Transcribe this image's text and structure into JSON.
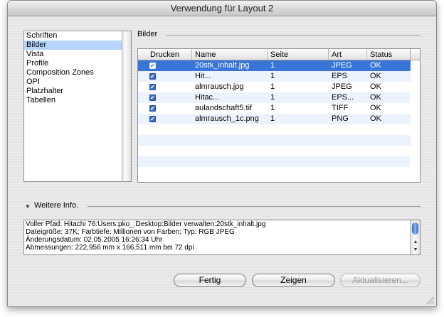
{
  "window": {
    "title": "Verwendung für Layout 2"
  },
  "categories": [
    {
      "label": "Schriften",
      "selected": false
    },
    {
      "label": "Bilder",
      "selected": true
    },
    {
      "label": "Vista",
      "selected": false
    },
    {
      "label": "Profile",
      "selected": false
    },
    {
      "label": "Composition Zones",
      "selected": false
    },
    {
      "label": "OPI",
      "selected": false
    },
    {
      "label": "Platzhalter",
      "selected": false
    },
    {
      "label": "Tabellen",
      "selected": false
    }
  ],
  "images_group": {
    "title": "Bilder",
    "columns": [
      "Drucken",
      "Name",
      "Seite",
      "Art",
      "Status"
    ],
    "rows": [
      {
        "print": true,
        "name": "20stk_inhalt.jpg",
        "page": "1",
        "type": "JPEG",
        "status": "OK",
        "selected": true
      },
      {
        "print": true,
        "name": "Hit...",
        "page": "1",
        "type": "EPS",
        "status": "OK",
        "selected": false
      },
      {
        "print": true,
        "name": "almrausch.jpg",
        "page": "1",
        "type": "JPEG",
        "status": "OK",
        "selected": false
      },
      {
        "print": true,
        "name": "Hitac...",
        "page": "1",
        "type": "EPS...",
        "status": "OK",
        "selected": false
      },
      {
        "print": true,
        "name": "aulandschaft5.tif",
        "page": "1",
        "type": "TIFF",
        "status": "OK",
        "selected": false
      },
      {
        "print": true,
        "name": "almrausch_1c.png",
        "page": "1",
        "type": "PNG",
        "status": "OK",
        "selected": false
      }
    ]
  },
  "more_info": {
    "title": "Weitere Info.",
    "lines": [
      "Voller Pfad: Hitachi 76:Users:pko_:Desktop:Bilder verwalten:20stk_inhalt.jpg",
      "Dateigröße: 37K;   Farbtiefe: Millionen von Farben;   Typ: RGB JPEG",
      "Änderungsdatum:   02.05.2005   16:26:34 Uhr",
      "Abmessungen: 222,956 mm x 166,511 mm bei 72 dpi"
    ]
  },
  "buttons": {
    "done": "Fertig",
    "show": "Zeigen",
    "update": "Aktualisieren..."
  },
  "icons": {
    "checkbox": "✔",
    "disclosure": "▼",
    "scroll_up": "▲",
    "scroll_down": "▼"
  },
  "colors": {
    "selection": "#3875d7",
    "list_selection": "#b5d5ff",
    "stripe": "#edf3fe"
  }
}
